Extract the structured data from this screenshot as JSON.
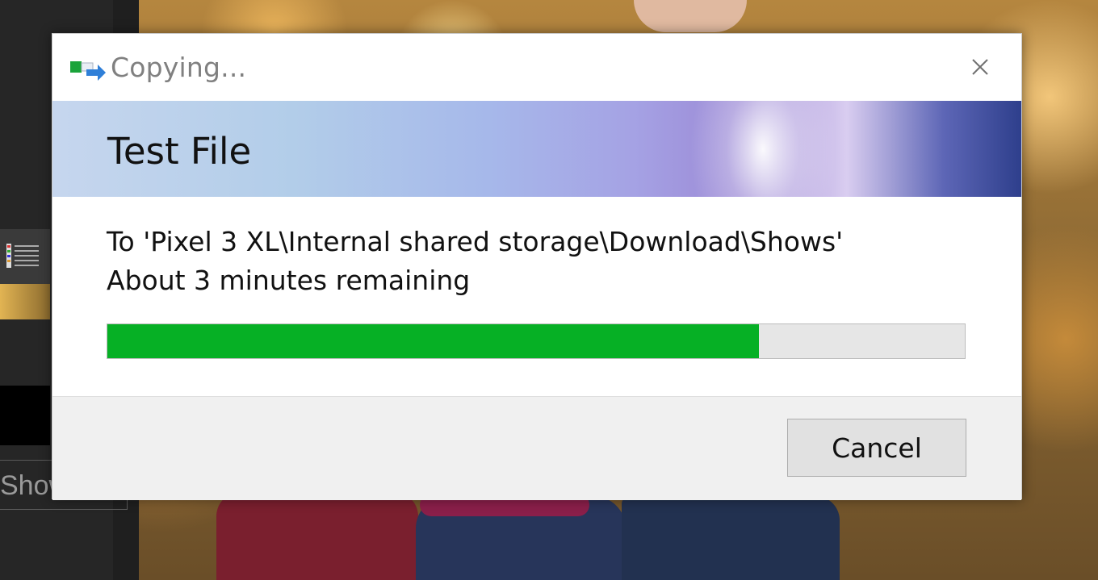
{
  "dialog": {
    "title": "Copying...",
    "title_icon": "copy-files-icon",
    "close_icon": "close-icon",
    "file_name": "Test File",
    "destination": "To 'Pixel 3 XL\\Internal shared storage\\Download\\Shows'",
    "time_remaining": "About 3 minutes remaining",
    "progress_percent": 76,
    "progress_color": "#06b025",
    "cancel_label": "Cancel"
  },
  "background_app": {
    "partial_label": "Show"
  }
}
